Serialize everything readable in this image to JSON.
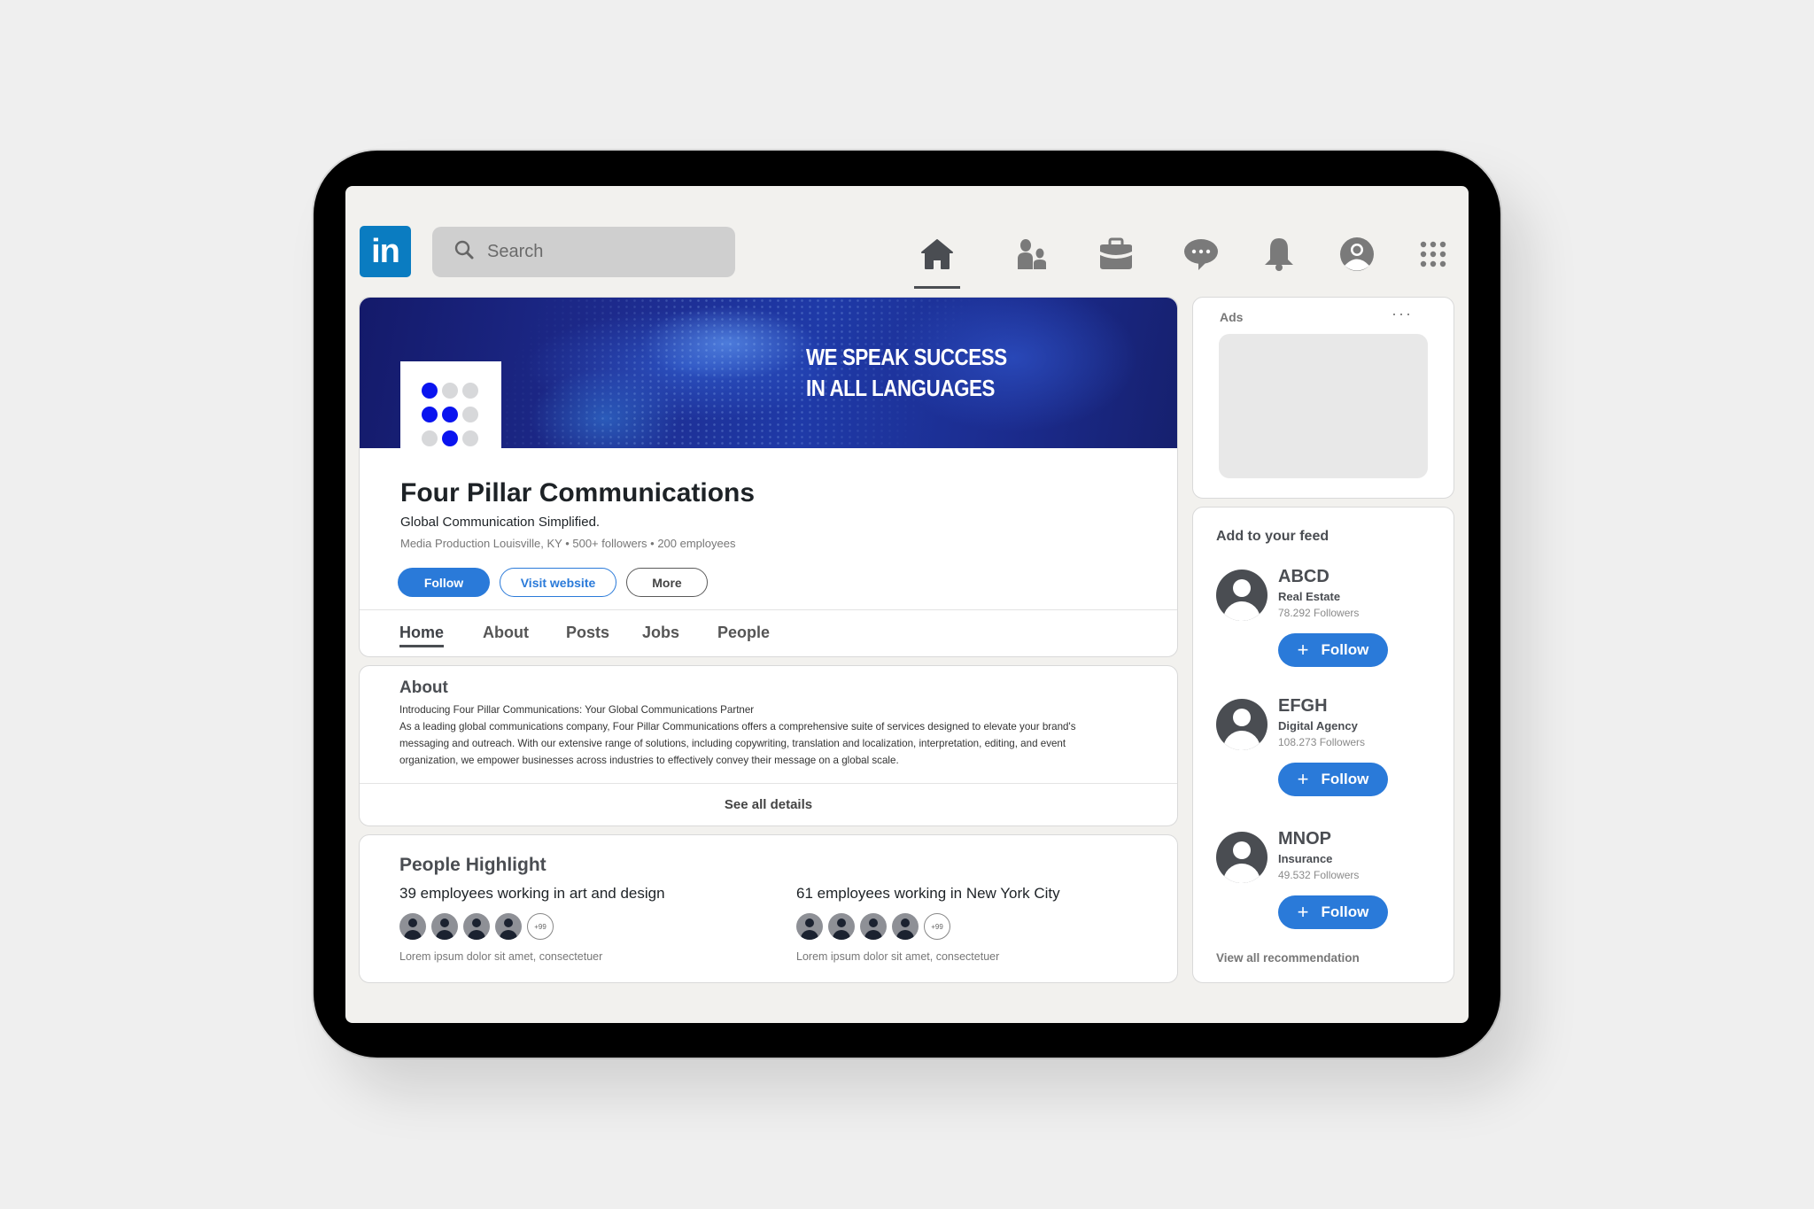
{
  "app": {
    "logo_text": "in",
    "brand_color": "#0a7cc1",
    "accent_color": "#2a7ad9"
  },
  "search": {
    "placeholder": "Search",
    "value": "",
    "icon": "search-icon"
  },
  "nav": {
    "items": [
      {
        "name": "home",
        "icon": "home-icon",
        "active": true
      },
      {
        "name": "my-network",
        "icon": "people-icon",
        "active": false
      },
      {
        "name": "jobs",
        "icon": "briefcase-icon",
        "active": false
      },
      {
        "name": "messaging",
        "icon": "chat-bubble-icon",
        "active": false
      },
      {
        "name": "notifications",
        "icon": "bell-icon",
        "active": false
      },
      {
        "name": "profile",
        "icon": "user-avatar-icon",
        "active": false
      },
      {
        "name": "apps",
        "icon": "grid-dots-icon",
        "active": false
      }
    ]
  },
  "company": {
    "banner_line1": "WE SPEAK SUCCESS",
    "banner_line2": "IN ALL LANGUAGES",
    "name": "Four Pillar Communications",
    "tagline": "Global Communication Simplified.",
    "meta": "Media Production Louisville, KY • 500+ followers • 200 employees",
    "buttons": {
      "follow": "Follow",
      "visit": "Visit website",
      "more": "More"
    },
    "tabs": [
      {
        "label": "Home",
        "active": true
      },
      {
        "label": "About",
        "active": false
      },
      {
        "label": "Posts",
        "active": false
      },
      {
        "label": "Jobs",
        "active": false
      },
      {
        "label": "People",
        "active": false
      }
    ]
  },
  "about": {
    "title": "About",
    "intro": "Introducing Four Pillar Communications: Your Global Communications Partner",
    "body": "As a leading global communications company, Four Pillar Communications offers a comprehensive suite of services designed to elevate your brand's messaging and outreach. With our extensive range of solutions, including copywriting, translation and localization, interpretation, editing, and event organization, we empower businesses across industries to effectively convey their message on a global scale.",
    "see_all": "See all details"
  },
  "people_highlight": {
    "title": "People Highlight",
    "groups": [
      {
        "heading": "39 employees working in art and design",
        "more_count": "+99",
        "subtext": "Lorem ipsum dolor sit amet, consectetuer"
      },
      {
        "heading": "61 employees working in New York City",
        "more_count": "+99",
        "subtext": "Lorem ipsum dolor sit amet, consectetuer"
      }
    ]
  },
  "ads": {
    "label": "Ads",
    "more": "···"
  },
  "feed": {
    "title": "Add to your feed",
    "follow_label": "Follow",
    "plus": "+",
    "recommendations": [
      {
        "name": "ABCD",
        "category": "Real Estate",
        "followers": "78.292 Followers"
      },
      {
        "name": "EFGH",
        "category": "Digital Agency",
        "followers": "108.273 Followers"
      },
      {
        "name": "MNOP",
        "category": "Insurance",
        "followers": "49.532 Followers"
      }
    ],
    "view_all": "View all recommendation"
  }
}
